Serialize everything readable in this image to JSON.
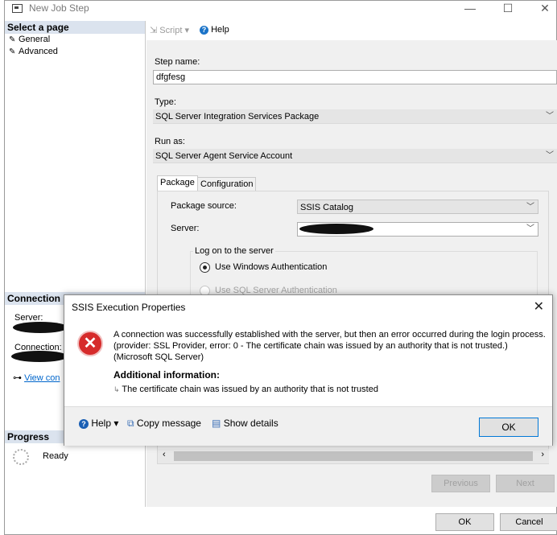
{
  "window": {
    "title": "New Job Step",
    "minimize": "—",
    "maximize": "☐",
    "close": "✕"
  },
  "left": {
    "select_page": "Select a page",
    "pages": [
      "General",
      "Advanced"
    ],
    "connection_header": "Connection",
    "server_label": "Server:",
    "connection_label": "Connection:",
    "view_connection": "View con",
    "progress_header": "Progress",
    "progress_status": "Ready"
  },
  "toolbar": {
    "script": "Script",
    "help": "Help"
  },
  "form": {
    "step_name_label": "Step name:",
    "step_name_value": "dfgfesg",
    "type_label": "Type:",
    "type_value": "SQL Server Integration Services Package",
    "run_as_label": "Run as:",
    "run_as_value": "SQL Server Agent Service Account",
    "tab_package": "Package",
    "tab_configuration": "Configuration",
    "package_source_label": "Package source:",
    "package_source_value": "SSIS Catalog",
    "server_label": "Server:",
    "logon_group": "Log on to the server",
    "windows_auth": "Use Windows Authentication",
    "sql_auth": "Use SQL Server Authentication"
  },
  "buttons": {
    "previous": "Previous",
    "next": "Next",
    "ok": "OK",
    "cancel": "Cancel"
  },
  "dialog": {
    "title": "SSIS Execution Properties",
    "message": "A connection was successfully established with the server, but then an error occurred during the login process. (provider: SSL Provider, error: 0 - The certificate chain was issued by an authority that is not trusted.) (Microsoft SQL Server)",
    "additional_header": "Additional information:",
    "additional_text": "The certificate chain was issued by an authority that is not trusted",
    "help": "Help",
    "copy_message": "Copy message",
    "show_details": "Show details",
    "ok": "OK"
  }
}
